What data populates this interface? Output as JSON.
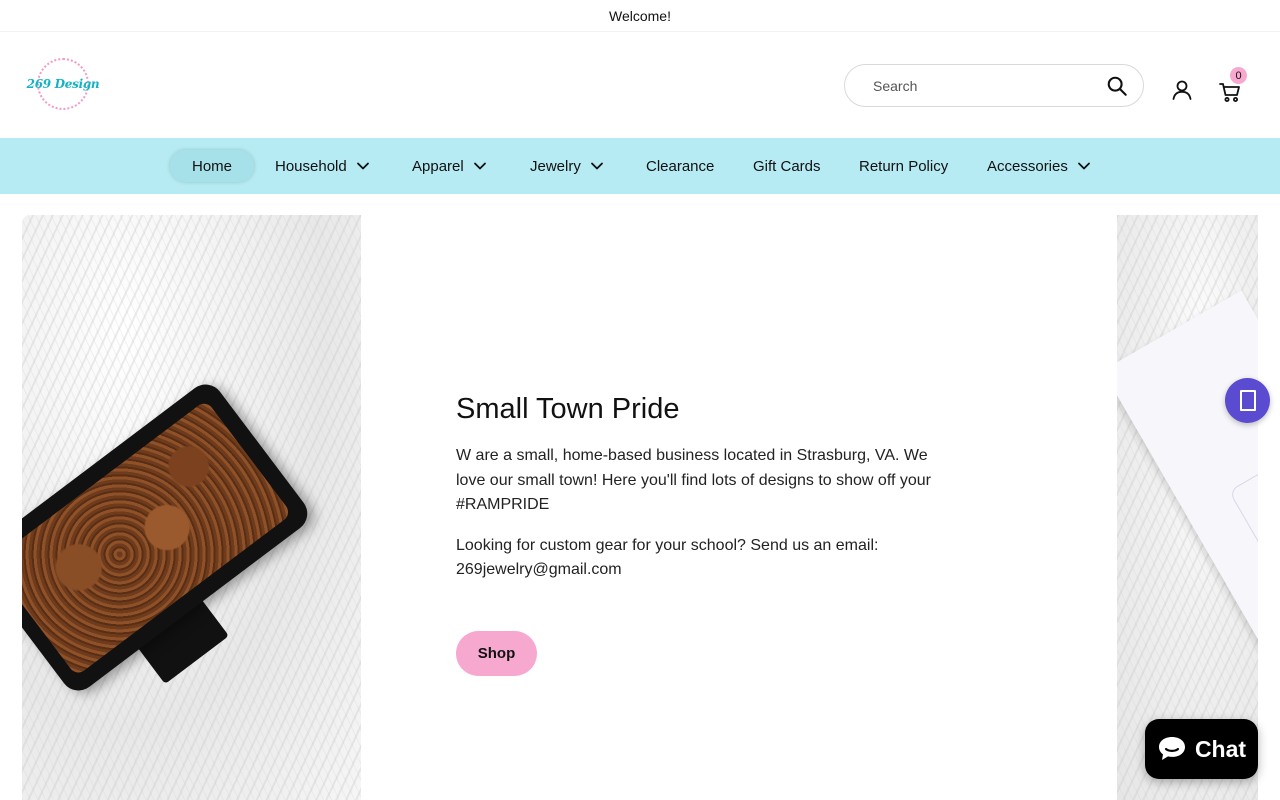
{
  "announcement": {
    "text": "Welcome!"
  },
  "header": {
    "logo_text": "269 Design",
    "search": {
      "placeholder": "Search",
      "value": ""
    },
    "cart": {
      "count": "0"
    }
  },
  "nav": {
    "items": [
      {
        "label": "Home",
        "active": true,
        "has_dropdown": false
      },
      {
        "label": "Household",
        "active": false,
        "has_dropdown": true
      },
      {
        "label": "Apparel",
        "active": false,
        "has_dropdown": true
      },
      {
        "label": "Jewelry",
        "active": false,
        "has_dropdown": true
      },
      {
        "label": "Clearance",
        "active": false,
        "has_dropdown": false
      },
      {
        "label": "Gift Cards",
        "active": false,
        "has_dropdown": false
      },
      {
        "label": "Return Policy",
        "active": false,
        "has_dropdown": false
      },
      {
        "label": "Accessories",
        "active": false,
        "has_dropdown": true
      }
    ]
  },
  "hero": {
    "title": "Small Town Pride",
    "paragraph_1": "W are a small, home-based business located in Strasburg, VA. We love our small town! Here you'll find lots of designs to show off your #RAMPRIDE",
    "paragraph_2": "Looking for custom gear for your school? Send us an email: 269jewelry@gmail.com",
    "button_label": "Shop"
  },
  "chat": {
    "label": "Chat"
  },
  "colors": {
    "nav_background": "#b6ebf3",
    "accent_pink": "#f7a8cf",
    "logo_teal": "#13b3c4",
    "widget_purple": "#5b4bd1",
    "chat_black": "#000000"
  },
  "icons": {
    "search": "search-icon",
    "account": "account-icon",
    "cart": "cart-icon",
    "dropdown": "chevron-down-icon",
    "chat": "chat-bubble-icon",
    "side_widget": "accessibility-widget-icon"
  }
}
